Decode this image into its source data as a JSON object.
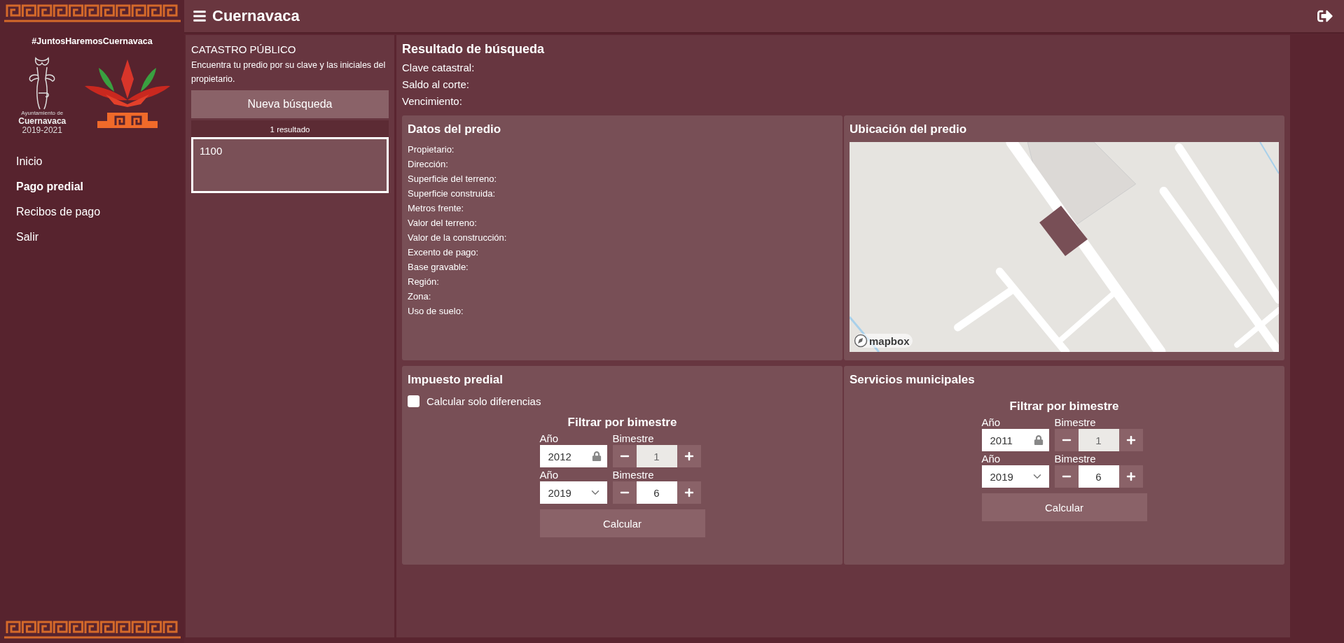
{
  "header": {
    "title": "Cuernavaca"
  },
  "sidebar": {
    "hashtag": "#JuntosHaremosCuernavaca",
    "logo_text": {
      "small": "Ayuntamiento de",
      "name": "Cuernavaca",
      "years": "2019-2021"
    },
    "items": [
      {
        "label": "Inicio",
        "selected": false
      },
      {
        "label": "Pago predial",
        "selected": true
      },
      {
        "label": "Recibos de pago",
        "selected": false
      },
      {
        "label": "Salir",
        "selected": false
      }
    ]
  },
  "search_panel": {
    "title": "CATASTRO PÚBLICO",
    "description": "Encuentra tu predio por su clave y las iniciales del propietario.",
    "button": "Nueva búsqueda",
    "result_count": "1 resultado",
    "results": [
      {
        "label": "1100",
        "selected": true
      }
    ]
  },
  "result": {
    "title": "Resultado de búsqueda",
    "fields": [
      "Clave catastral:",
      "Saldo al corte:",
      "Vencimiento:"
    ]
  },
  "property": {
    "title": "Datos del predio",
    "fields": [
      "Propietario:",
      "Dirección:",
      "Superficie del terreno:",
      "Superficie construida:",
      "Metros frente:",
      "Valor del terreno:",
      "Valor de la construcción:",
      "Excento de pago:",
      "Base gravable:",
      "Región:",
      "Zona:",
      "Uso de suelo:"
    ]
  },
  "location": {
    "title": "Ubicación del predio",
    "attribution": "mapbox"
  },
  "tax": {
    "title": "Impuesto predial",
    "checkbox": {
      "label": "Calcular solo diferencias",
      "checked": false
    },
    "filter": {
      "title": "Filtrar por bimestre",
      "button": "Calcular",
      "rows": [
        {
          "kind": "locked",
          "year_label": "Año",
          "year": "2012",
          "period_label": "Bimestre",
          "period": "1",
          "disabled": true
        },
        {
          "kind": "select",
          "year_label": "Año",
          "year": "2019",
          "period_label": "Bimestre",
          "period": "6",
          "disabled": false
        }
      ]
    }
  },
  "services": {
    "title": "Servicios municipales",
    "filter": {
      "title": "Filtrar por bimestre",
      "button": "Calcular",
      "rows": [
        {
          "kind": "locked",
          "year_label": "Año",
          "year": "2011",
          "period_label": "Bimestre",
          "period": "1",
          "disabled": true
        },
        {
          "kind": "select",
          "year_label": "Año",
          "year": "2019",
          "period_label": "Bimestre",
          "period": "6",
          "disabled": false
        }
      ]
    }
  }
}
